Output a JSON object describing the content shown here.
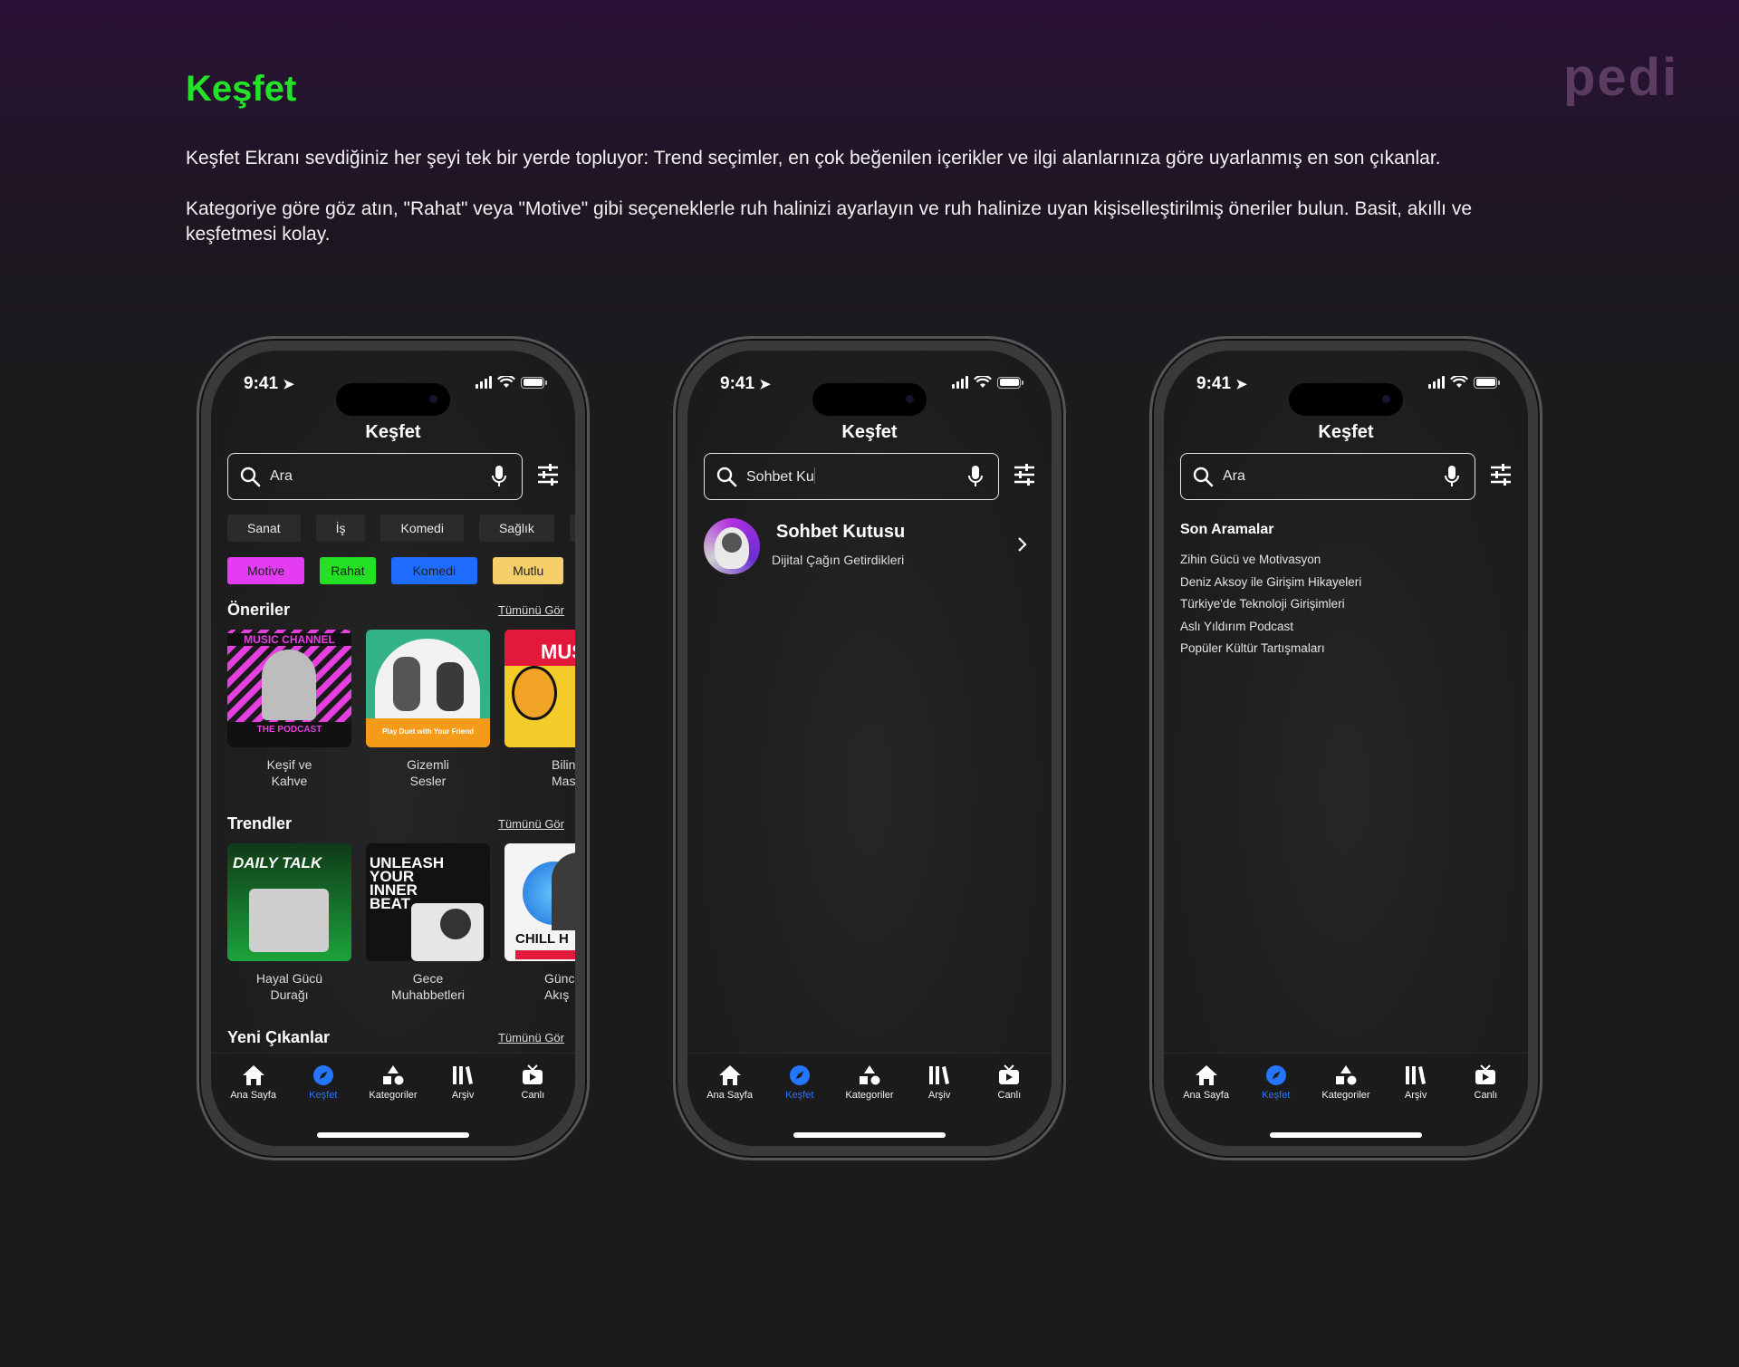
{
  "logo": "pedi",
  "page": {
    "title": "Keşfet",
    "desc1": "Keşfet Ekranı sevdiğiniz her şeyi tek bir yerde topluyor: Trend seçimler, en çok beğenilen içerikler ve ilgi alanlarınıza göre uyarlanmış en son çıkanlar.",
    "desc2": "Kategoriye göre göz atın, \"Rahat\" veya \"Motive\" gibi seçeneklerle ruh halinizi ayarlayın ve ruh halinize uyan kişiselleştirilmiş öneriler bulun. Basit, akıllı ve keşfetmesi kolay."
  },
  "status": {
    "time": "9:41"
  },
  "screen_title": "Keşfet",
  "search": {
    "placeholder": "Ara",
    "typed": "Sohbet Ku"
  },
  "categories": [
    "Sanat",
    "İş",
    "Komedi",
    "Sağlık"
  ],
  "moods": [
    {
      "label": "Motive",
      "color": "#e43cf2"
    },
    {
      "label": "Rahat",
      "color": "#24e024"
    },
    {
      "label": "Komedi",
      "color": "#1f6dff"
    },
    {
      "label": "Mutlu",
      "color": "#f4cf6a"
    }
  ],
  "see_all": "Tümünü Gör",
  "sections": {
    "oneriler": {
      "title": "Öneriler",
      "items": [
        {
          "caption": "Keşif ve\nKahve",
          "art_text_top": "MUSIC CHANNEL",
          "art_text_bottom": "THE PODCAST"
        },
        {
          "caption": "Gizemli\nSesler",
          "art_text_bottom": "Play Duet with Your Friend"
        },
        {
          "caption": "Bilin\nMasa",
          "art_text_top": "MUSI"
        }
      ]
    },
    "trendler": {
      "title": "Trendler",
      "items": [
        {
          "caption": "Hayal Gücü\nDurağı",
          "art_text_top": "DAILY TALK"
        },
        {
          "caption": "Gece\nMuhabbetleri",
          "art_text_top": "UNLEASH YOUR INNER BEAT"
        },
        {
          "caption": "Günc\nAkış",
          "art_text_bottom": "CHILL H"
        }
      ]
    },
    "yeni": {
      "title": "Yeni Çıkanlar"
    }
  },
  "result": {
    "title": "Sohbet Kutusu",
    "subtitle": "Dijital Çağın Getirdikleri"
  },
  "recent": {
    "title": "Son Aramalar",
    "items": [
      "Zihin Gücü ve Motivasyon",
      "Deniz Aksoy ile Girişim Hikayeleri",
      "Türkiye'de Teknoloji Girişimleri",
      "Aslı Yıldırım Podcast",
      "Popüler Kültür Tartışmaları"
    ]
  },
  "tabs": [
    "Ana Sayfa",
    "Keşfet",
    "Kategoriler",
    "Arşiv",
    "Canlı"
  ],
  "colors": {
    "accent_green": "#22e22a",
    "tab_active": "#2475ff"
  }
}
